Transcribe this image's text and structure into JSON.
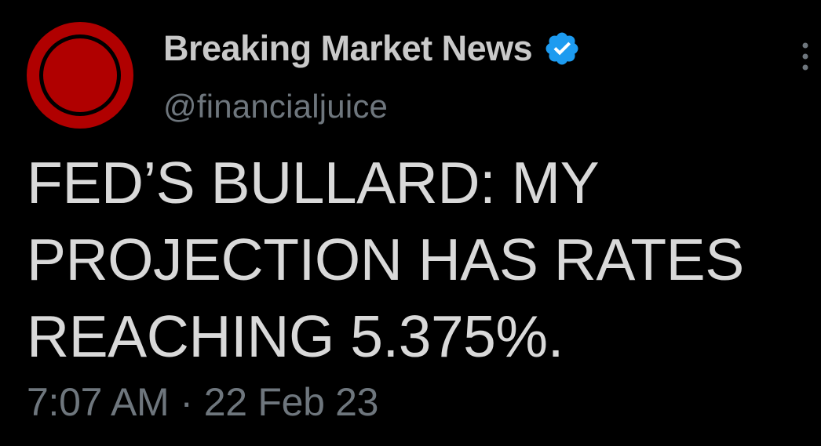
{
  "account": {
    "display_name": "Breaking Market News",
    "handle": "@financialjuice",
    "avatar_icon": "red-target-logo",
    "verified": true,
    "verified_icon": "verified-badge-icon"
  },
  "colors": {
    "background": "#000000",
    "text_primary": "#d9d9d9",
    "text_secondary": "#6e767d",
    "verified_blue": "#1d9bf0",
    "avatar_red": "#b00000"
  },
  "tweet": {
    "lines": [
      "FED’S BULLARD: MY",
      "PROJECTION HAS RATES",
      "REACHING 5.375%."
    ]
  },
  "meta": {
    "time": "7:07 AM",
    "separator": "·",
    "date": "22 Feb 23"
  },
  "menu": {
    "icon": "more-options-icon"
  }
}
